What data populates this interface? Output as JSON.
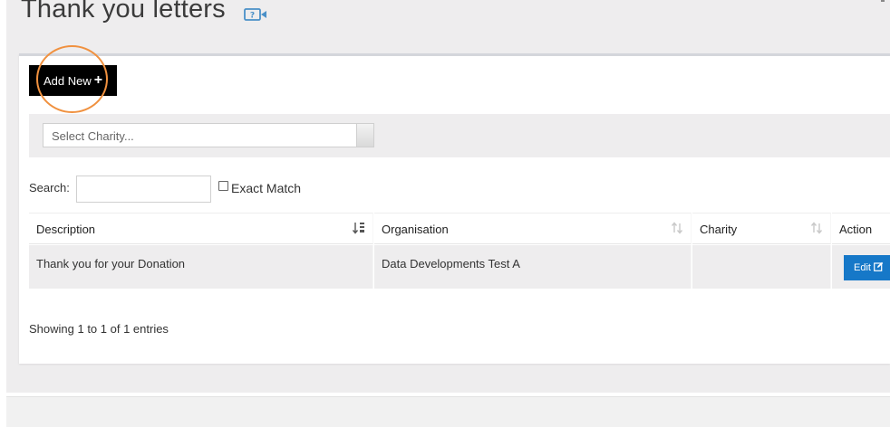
{
  "page": {
    "title": "Thank you letters",
    "title_icon": "video-help-icon"
  },
  "toolbar": {
    "add_new_label": "Add New",
    "add_new_icon": "plus-icon"
  },
  "filter": {
    "charity_placeholder": "Select Charity..."
  },
  "search": {
    "label": "Search:",
    "value": "",
    "exact_match_label": "Exact Match",
    "exact_match_checked": false
  },
  "table": {
    "columns": [
      {
        "label": "Description",
        "sort": "ascending"
      },
      {
        "label": "Organisation",
        "sort": "none"
      },
      {
        "label": "Charity",
        "sort": "none"
      },
      {
        "label": "Action",
        "sort": "none"
      }
    ],
    "rows": [
      {
        "description": "Thank you for your Donation",
        "organisation": "Data Developments Test A",
        "charity": "",
        "action_label": "Edit",
        "action_icon": "edit-icon"
      }
    ],
    "info": "Showing 1 to 1 of 1 entries"
  },
  "colors": {
    "primary_button": "#000000",
    "edit_button": "#1678c8",
    "highlight": "#f0913f",
    "title_icon": "#4a90c8"
  }
}
